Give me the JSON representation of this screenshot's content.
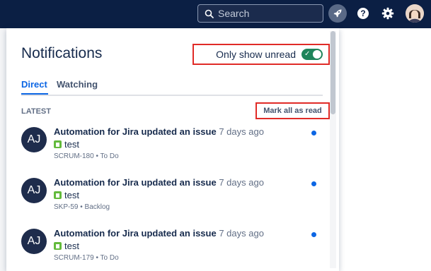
{
  "topbar": {
    "search_placeholder": "Search",
    "icons": [
      "search-icon",
      "rocket-icon",
      "help-icon",
      "settings-icon",
      "avatar"
    ]
  },
  "panel": {
    "title": "Notifications",
    "only_unread_label": "Only show unread",
    "only_unread_on": true,
    "tabs": [
      {
        "label": "Direct",
        "active": true
      },
      {
        "label": "Watching",
        "active": false
      }
    ],
    "section_label": "LATEST",
    "mark_all_label": "Mark all as read",
    "notifications": [
      {
        "avatar_initials": "AJ",
        "actor": "Automation for Jira updated an issue",
        "time": "7 days ago",
        "summary": "test",
        "issue_key": "SCRUM-180",
        "status": "To Do",
        "meta": "SCRUM-180 • To Do",
        "unread": true
      },
      {
        "avatar_initials": "AJ",
        "actor": "Automation for Jira updated an issue",
        "time": "7 days ago",
        "summary": "test",
        "issue_key": "SKP-59",
        "status": "Backlog",
        "meta": "SKP-59 • Backlog",
        "unread": true
      },
      {
        "avatar_initials": "AJ",
        "actor": "Automation for Jira updated an issue",
        "time": "7 days ago",
        "summary": "test",
        "issue_key": "SCRUM-179",
        "status": "To Do",
        "meta": "SCRUM-179 • To Do",
        "unread": true
      }
    ]
  },
  "colors": {
    "nav_bg": "#0b1f44",
    "accent": "#0c66e4",
    "toggle_on": "#1f845a",
    "highlight_box": "#e02b27",
    "story": "#63ba3c"
  }
}
